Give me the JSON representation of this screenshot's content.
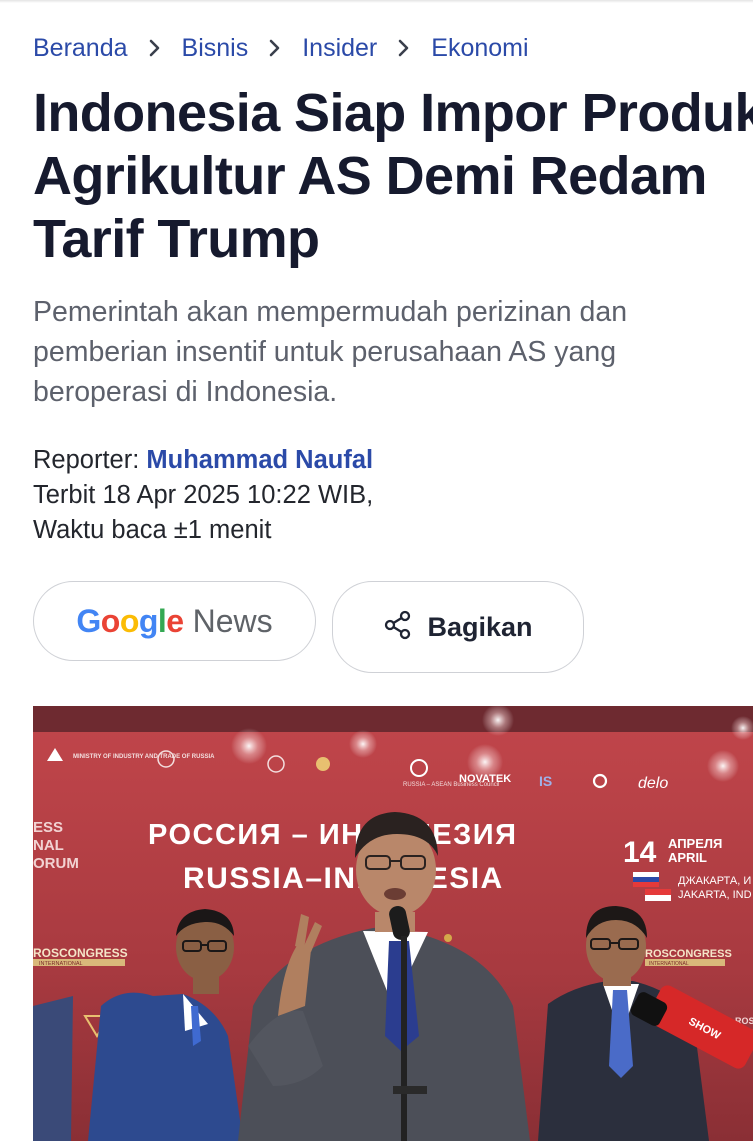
{
  "breadcrumb": {
    "items": [
      {
        "label": "Beranda"
      },
      {
        "label": "Bisnis"
      },
      {
        "label": "Insider"
      },
      {
        "label": "Ekonomi"
      }
    ]
  },
  "article": {
    "title_lines": [
      "Indonesia Siap Impor Produk",
      "Agrikultur AS Demi Redam",
      "Tarif Trump"
    ],
    "subtitle": "Pemerintah akan mempermudah perizinan dan pemberian insentif untuk perusahaan AS yang beroperasi di Indonesia.",
    "reporter_label": "Reporter: ",
    "reporter_name": "Muhammad Naufal",
    "published": "Terbit 18 Apr 2025 10:22 WIB,",
    "read_time": "Waktu baca ±1 menit"
  },
  "actions": {
    "google_news": {
      "logo_letters": [
        "G",
        "o",
        "o",
        "g",
        "l",
        "e"
      ],
      "news_word": "News"
    },
    "share_label": "Bagikan"
  },
  "photo": {
    "banner_ru": "РОССИЯ – ИНДОНЕЗИЯ",
    "banner_en": "RUSSIA–INDONESIA",
    "date_number": "14",
    "date_ru": "АПРЕЛЯ",
    "date_en": "APRIL",
    "city_ru": "ДЖАКАРТА, И",
    "city_en": "JAKARTA, IND",
    "forum_left": [
      "ESS",
      "NAL",
      "ORUM"
    ],
    "roscongress": "ROSCONGRESS",
    "roscongress_sub": "INTERNATIONAL",
    "sponsor_ministry": "MINISTRY OF INDUSTRY AND TRADE OF RUSSIA",
    "sponsor_novatek": "NOVATEK",
    "sponsor_council": "RUSSIA – ASEAN Business Council",
    "sponsor_delo": "delo",
    "mic_label": "SHOW"
  },
  "colors": {
    "link": "#2b4aa8",
    "title": "#161a2e",
    "subtitle": "#5d616c",
    "banner_red": "#b8383f",
    "google_blue": "#4285F4",
    "google_red": "#EA4335",
    "google_yellow": "#FBBC05",
    "google_green": "#34A853"
  },
  "icons": {
    "breadcrumb_separator": "chevron-right-icon",
    "share": "share-icon"
  }
}
